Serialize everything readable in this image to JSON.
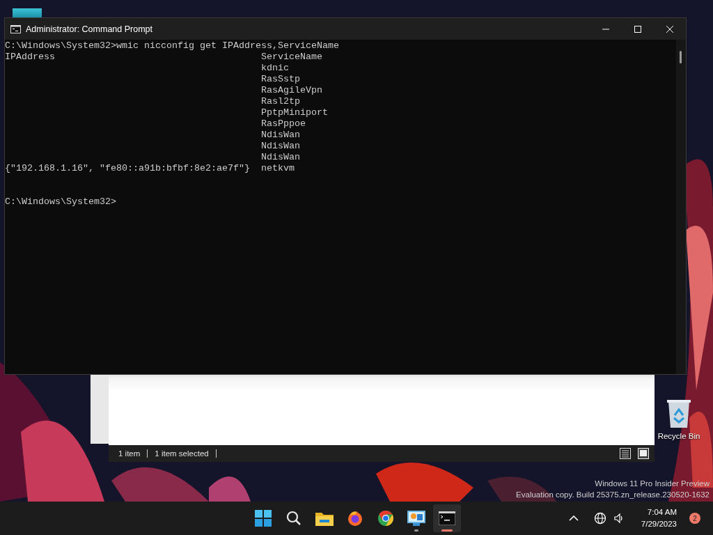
{
  "console_window": {
    "title": "Administrator: Command Prompt",
    "command_line": "C:\\Windows\\System32>wmic nicconfig get IPAddress,ServiceName",
    "columns": [
      "IPAddress",
      "ServiceName"
    ],
    "rows": [
      {
        "ip_address": "",
        "service_name": "kdnic"
      },
      {
        "ip_address": "",
        "service_name": "RasSstp"
      },
      {
        "ip_address": "",
        "service_name": "RasAgileVpn"
      },
      {
        "ip_address": "",
        "service_name": "Rasl2tp"
      },
      {
        "ip_address": "",
        "service_name": "PptpMiniport"
      },
      {
        "ip_address": "",
        "service_name": "RasPppoe"
      },
      {
        "ip_address": "",
        "service_name": "NdisWan"
      },
      {
        "ip_address": "",
        "service_name": "NdisWan"
      },
      {
        "ip_address": "",
        "service_name": "NdisWan"
      },
      {
        "ip_address": "{\"192.168.1.16\", \"fe80::a91b:bfbf:8e2:ae7f\"}",
        "service_name": "netkvm"
      }
    ],
    "prompt": "C:\\Windows\\System32>"
  },
  "explorer_window": {
    "status_items": [
      "1 item",
      "1 item selected"
    ]
  },
  "desktop": {
    "icons": [
      {
        "label": "Recycle Bin"
      }
    ],
    "watermark_lines": [
      "Windows 11 Pro Insider Preview",
      "Evaluation copy. Build 25375.zn_release.230520-1632"
    ]
  },
  "taskbar": {
    "apps": [
      {
        "kind": "start",
        "running": false,
        "active": false
      },
      {
        "kind": "search",
        "running": false,
        "active": false
      },
      {
        "kind": "folder",
        "running": false,
        "active": false
      },
      {
        "kind": "firefox",
        "running": false,
        "active": false
      },
      {
        "kind": "chrome",
        "running": false,
        "active": false
      },
      {
        "kind": "monitor",
        "running": true,
        "active": false
      },
      {
        "kind": "terminal",
        "running": true,
        "active": true
      }
    ],
    "time": "7:04 AM",
    "date": "7/29/2023",
    "notification_count": "2"
  }
}
